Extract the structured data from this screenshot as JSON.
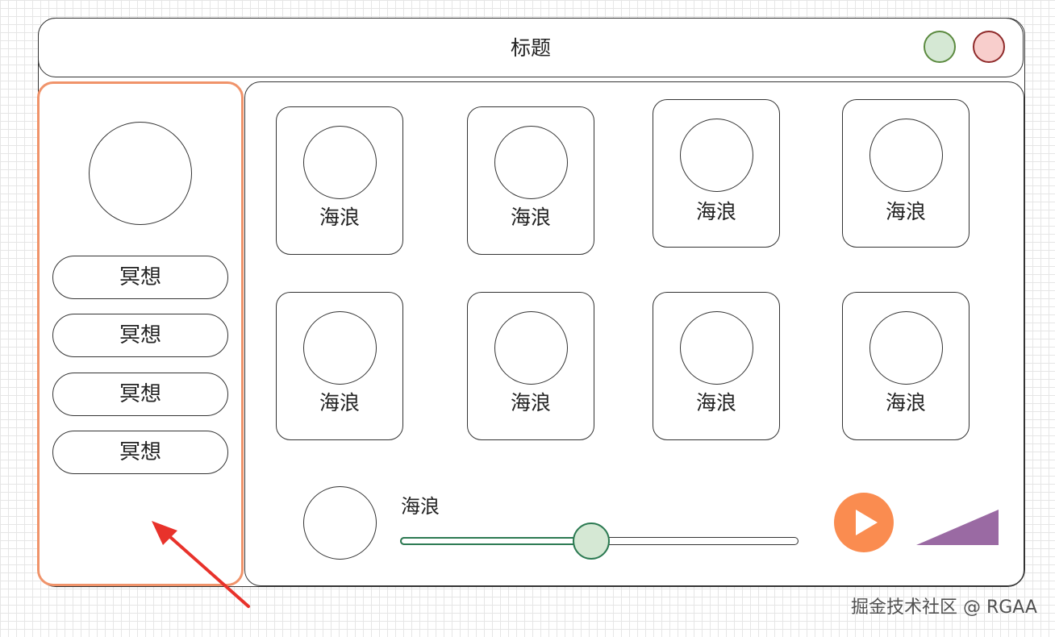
{
  "window": {
    "title": "标题"
  },
  "window_controls": {
    "green_color": "#d5e8d4",
    "red_color": "#f8cecc"
  },
  "sidebar": {
    "highlight_color": "#f0936a",
    "items": [
      {
        "label": "冥想"
      },
      {
        "label": "冥想"
      },
      {
        "label": "冥想"
      },
      {
        "label": "冥想"
      }
    ]
  },
  "grid": {
    "cards": [
      {
        "label": "海浪"
      },
      {
        "label": "海浪"
      },
      {
        "label": "海浪"
      },
      {
        "label": "海浪"
      },
      {
        "label": "海浪"
      },
      {
        "label": "海浪"
      },
      {
        "label": "海浪"
      },
      {
        "label": "海浪"
      }
    ]
  },
  "player": {
    "track_title": "海浪",
    "progress_fraction": 0.48,
    "progress_color": "#2c7a52",
    "play_button_color": "#fa8c50",
    "play_icon": "play-icon",
    "volume_icon": "volume-icon",
    "volume_color": "#9a6aa3"
  },
  "annotation": {
    "arrow_color": "#e8322b"
  },
  "watermark": "掘金技术社区 @ RGAA"
}
